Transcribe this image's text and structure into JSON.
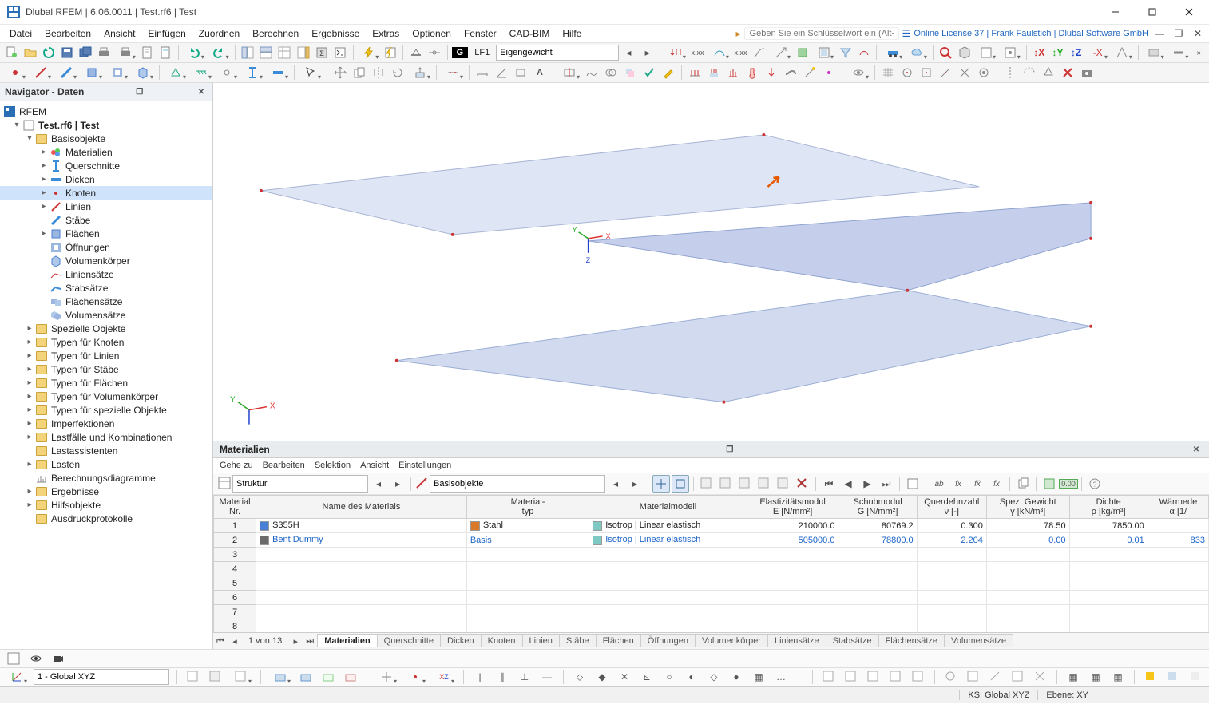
{
  "title": "Dlubal RFEM | 6.06.0011 | Test.rf6 | Test",
  "menus": [
    "Datei",
    "Bearbeiten",
    "Ansicht",
    "Einfügen",
    "Zuordnen",
    "Berechnen",
    "Ergebnisse",
    "Extras",
    "Optionen",
    "Fenster",
    "CAD-BIM",
    "Hilfe"
  ],
  "search_placeholder": "Geben Sie ein Schlüsselwort ein (Alt+Q)",
  "license_text": "Online License 37 | Frank Faulstich | Dlubal Software GmbH",
  "loadcase": {
    "badge": "G",
    "code": "LF1",
    "name": "Eigengewicht"
  },
  "navigator": {
    "title": "Navigator - Daten",
    "root": "RFEM",
    "model": "Test.rf6 | Test",
    "basis": "Basisobjekte",
    "basis_children": [
      "Materialien",
      "Querschnitte",
      "Dicken",
      "Knoten",
      "Linien",
      "Stäbe",
      "Flächen",
      "Öffnungen",
      "Volumenkörper",
      "Liniensätze",
      "Stabsätze",
      "Flächensätze",
      "Volumensätze"
    ],
    "selected": "Knoten",
    "other": [
      "Spezielle Objekte",
      "Typen für Knoten",
      "Typen für Linien",
      "Typen für Stäbe",
      "Typen für Flächen",
      "Typen für Volumenkörper",
      "Typen für spezielle Objekte",
      "Imperfektionen",
      "Lastfälle und Kombinationen",
      "Lastassistenten",
      "Lasten",
      "Berechnungsdiagramme",
      "Ergebnisse",
      "Hilfsobjekte",
      "Ausdruckprotokolle"
    ]
  },
  "panel": {
    "title": "Materialien",
    "menus": [
      "Gehe zu",
      "Bearbeiten",
      "Selektion",
      "Ansicht",
      "Einstellungen"
    ],
    "combo1": "Struktur",
    "combo2": "Basisobjekte",
    "columns": {
      "num": "Material\nNr.",
      "name": "Name des Materials",
      "type": "Material-\ntyp",
      "model": "Materialmodell",
      "e": "Elastizitätsmodul\nE [N/mm²]",
      "g": "Schubmodul\nG [N/mm²]",
      "nu": "Querdehnzahl\nν [-]",
      "gamma": "Spez. Gewicht\nγ [kN/m³]",
      "rho": "Dichte\nρ [kg/m³]",
      "alpha": "Wärmede\nα [1/"
    },
    "rows": [
      {
        "n": "1",
        "name": "S355H",
        "type": "Stahl",
        "model": "Isotrop | Linear elastisch",
        "e": "210000.0",
        "g": "80769.2",
        "nu": "0.300",
        "gamma": "78.50",
        "rho": "7850.00",
        "alpha": "",
        "sw": "#4a7fd6",
        "tsw": "#d97a2b",
        "msw": "#7fc9c4",
        "blue": false
      },
      {
        "n": "2",
        "name": "Bent Dummy",
        "type": "Basis",
        "model": "Isotrop | Linear elastisch",
        "e": "505000.0",
        "g": "78800.0",
        "nu": "2.204",
        "gamma": "0.00",
        "rho": "0.01",
        "alpha": "833",
        "sw": "#6b6b6b",
        "tsw": "",
        "msw": "#7fc9c4",
        "blue": true
      }
    ],
    "tabstrip": {
      "counter": "1 von 13",
      "tabs": [
        "Materialien",
        "Querschnitte",
        "Dicken",
        "Knoten",
        "Linien",
        "Stäbe",
        "Flächen",
        "Öffnungen",
        "Volumenkörper",
        "Liniensätze",
        "Stabsätze",
        "Flächensätze",
        "Volumensätze"
      ]
    }
  },
  "midbar": {
    "combo": "1 - Global XYZ"
  },
  "status": {
    "ks": "KS: Global XYZ",
    "ebene": "Ebene: XY"
  },
  "axes": {
    "x": "X",
    "y": "Y",
    "z": "Z"
  }
}
